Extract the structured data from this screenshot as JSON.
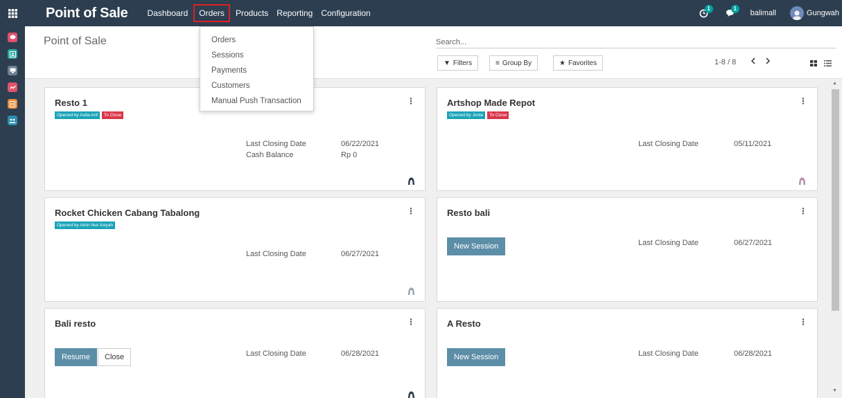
{
  "topbar": {
    "brand": "Point of Sale",
    "menu": [
      {
        "label": "Dashboard",
        "active": false
      },
      {
        "label": "Orders",
        "active": true
      },
      {
        "label": "Products",
        "active": false
      },
      {
        "label": "Reporting",
        "active": false
      },
      {
        "label": "Configuration",
        "active": false
      }
    ],
    "activity_count": "1",
    "messages_count": "1",
    "company": "balimall",
    "user": "Gungwah"
  },
  "sidebar": {
    "apps": [
      {
        "icon": "discuss-icon",
        "color": "#e0526b"
      },
      {
        "icon": "contacts-icon",
        "color": "#2fa8a0"
      },
      {
        "icon": "pos-icon",
        "color": "#6f7f8f"
      },
      {
        "icon": "sales-icon",
        "color": "#e0526b"
      },
      {
        "icon": "invoicing-icon",
        "color": "#e98a3a"
      },
      {
        "icon": "employees-icon",
        "color": "#2e8fb0"
      }
    ]
  },
  "control": {
    "breadcrumb": "Point of Sale",
    "search_placeholder": "Search...",
    "filters_label": "Filters",
    "groupby_label": "Group By",
    "favorites_label": "Favorites",
    "pager": "1-8 / 8"
  },
  "orders_dropdown": {
    "items": [
      "Orders",
      "Sessions",
      "Payments",
      "Customers",
      "Manual Push Transaction"
    ]
  },
  "cards": [
    {
      "title": "Resto 1",
      "tags": [
        {
          "label": "Opened by Aulia Arif",
          "kind": "teal"
        },
        {
          "label": "To Close",
          "kind": "red"
        }
      ],
      "rows": [
        {
          "label": "Last Closing Date",
          "value": "06/22/2021"
        },
        {
          "label": "Cash Balance",
          "value": "Rp 0"
        }
      ]
    },
    {
      "title": "Artshop Made Repot",
      "tags": [
        {
          "label": "Opened by Jonie",
          "kind": "teal"
        },
        {
          "label": "To Close",
          "kind": "red"
        }
      ],
      "rows": [
        {
          "label": "Last Closing Date",
          "value": "05/11/2021"
        }
      ]
    },
    {
      "title": "Rocket Chicken Cabang Tabalong",
      "tags": [
        {
          "label": "Opened by Ainin Nur Asiyah",
          "kind": "teal"
        }
      ],
      "rows": [
        {
          "label": "Last Closing Date",
          "value": "06/27/2021"
        }
      ]
    },
    {
      "title": "Resto bali",
      "tags": [],
      "button": "New Session",
      "rows": [
        {
          "label": "Last Closing Date",
          "value": "06/27/2021"
        }
      ]
    },
    {
      "title": "Bali resto",
      "tags": [],
      "button": "Resume",
      "button2": "Close",
      "rows": [
        {
          "label": "Last Closing Date",
          "value": "06/28/2021"
        }
      ]
    },
    {
      "title": "A Resto",
      "tags": [],
      "button": "New Session",
      "rows": [
        {
          "label": "Last Closing Date",
          "value": "06/28/2021"
        }
      ]
    }
  ],
  "colors": {
    "navbar": "#2c3e50",
    "primary_button": "#5d8ea7",
    "tag_teal": "#1aa3b8",
    "tag_red": "#d9364a",
    "active_outline": "#e02020"
  }
}
